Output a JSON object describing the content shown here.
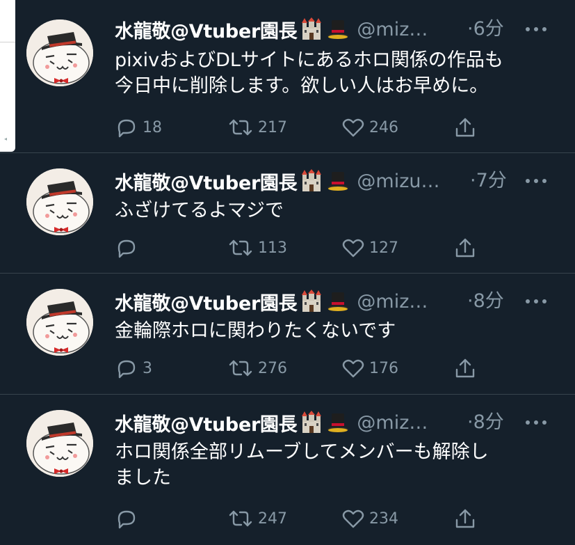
{
  "tweets": [
    {
      "name": "水龍敬@Vtuber園長",
      "handle": "@miz…",
      "time": "·6分",
      "lines": [
        "pixivおよびDLサイトにあるホロ関係の作品も",
        "今日中に削除します。欲しい人はお早めに。"
      ],
      "replies": "18",
      "retweets": "217",
      "likes": "246"
    },
    {
      "name": "水龍敬@Vtuber園長",
      "handle": "@mizu…",
      "time": "·7分",
      "lines": [
        "ふざけてるよマジで"
      ],
      "replies": "",
      "retweets": "113",
      "likes": "127"
    },
    {
      "name": "水龍敬@Vtuber園長",
      "handle": "@miz…",
      "time": "·8分",
      "lines": [
        "金輪際ホロに関わりたくないです"
      ],
      "replies": "3",
      "retweets": "276",
      "likes": "176"
    },
    {
      "name": "水龍敬@Vtuber園長",
      "handle": "@miz…",
      "time": "·8分",
      "lines": [
        "ホロ関係全部リムーブしてメンバーも解除し",
        "ました"
      ],
      "replies": "",
      "retweets": "247",
      "likes": "234"
    }
  ],
  "icons": {
    "castle": "castle-emoji-icon",
    "tophat": "tophat-emoji-icon",
    "reply": "reply-icon",
    "retweet": "retweet-icon",
    "like": "heart-icon",
    "share": "share-icon",
    "more": "more-icon"
  },
  "colors": {
    "background": "#15202b",
    "divider": "#38444d",
    "muted": "#8899a6",
    "text": "#ffffff"
  }
}
